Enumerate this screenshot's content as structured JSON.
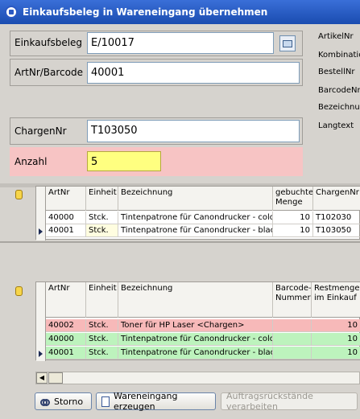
{
  "window": {
    "title": "Einkaufsbeleg in Wareneingang übernehmen"
  },
  "form": {
    "einkaufsbeleg_label": "Einkaufsbeleg",
    "einkaufsbeleg_value": "E/10017",
    "artnr_label": "ArtNr/Barcode",
    "artnr_value": "40001",
    "chargen_label": "ChargenNr",
    "chargen_value": "T103050",
    "anzahl_label": "Anzahl",
    "anzahl_value": "5"
  },
  "side_labels": [
    "ArtikelNr",
    "Kombinatio",
    "BestellNr",
    "BarcodeNr",
    "Bezeichnu",
    "Langtext"
  ],
  "top_grid": {
    "headers": [
      "ArtNr",
      "Einheit",
      "Bezeichnung",
      "gebuchte Menge",
      "ChargenNr"
    ],
    "rows": [
      {
        "artnr": "40000",
        "einheit": "Stck.",
        "bezeichnung": "Tintenpatrone für Canondrucker - color",
        "menge": "10",
        "charge": "T102030"
      },
      {
        "artnr": "40001",
        "einheit": "Stck.",
        "bezeichnung": "Tintenpatrone für Canondrucker - black",
        "menge": "10",
        "charge": "T103050"
      }
    ]
  },
  "bottom_grid": {
    "headers": [
      "ArtNr",
      "Einheit",
      "Bezeichnung",
      "Barcode-Nummer",
      "Restmenge im Einkauf"
    ],
    "rows": [
      {
        "artnr": "40002",
        "einheit": "Stck.",
        "bezeichnung": "Toner für HP Laser <Chargen>",
        "barcode": "",
        "rest": "10",
        "status": "pink"
      },
      {
        "artnr": "40000",
        "einheit": "Stck.",
        "bezeichnung": "Tintenpatrone für Canondrucker - color",
        "barcode": "",
        "rest": "10",
        "status": "green"
      },
      {
        "artnr": "40001",
        "einheit": "Stck.",
        "bezeichnung": "Tintenpatrone für Canondrucker - black",
        "barcode": "",
        "rest": "10",
        "status": "green"
      }
    ]
  },
  "buttons": {
    "storno": "Storno",
    "wareneingang": "Wareneingang erzeugen",
    "auftrag": "Auftragsrückstände verarbeiten"
  },
  "colors": {
    "pink_row": "#f7b9b9",
    "green_row": "#bdf3bd",
    "anzahl_bg": "#f7c4c4",
    "input_highlight": "#ffff80"
  }
}
